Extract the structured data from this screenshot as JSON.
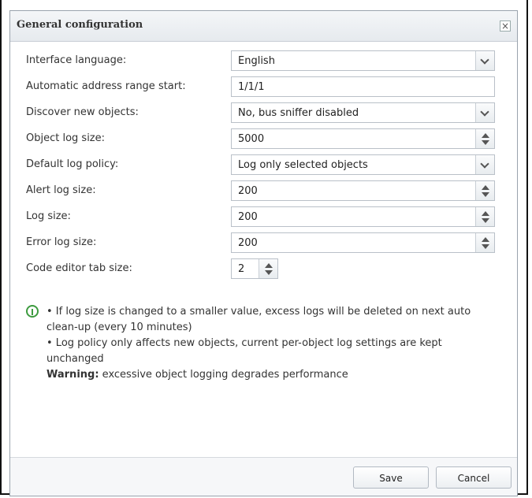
{
  "dialog": {
    "title": "General configuration",
    "close_label": "×"
  },
  "fields": [
    {
      "label": "Interface language:",
      "value": "English",
      "control": "select"
    },
    {
      "label": "Automatic address range start:",
      "value": "1/1/1",
      "control": "text"
    },
    {
      "label": "Discover new objects:",
      "value": "No, bus sniffer disabled",
      "control": "select"
    },
    {
      "label": "Object log size:",
      "value": "5000",
      "control": "spinner"
    },
    {
      "label": "Default log policy:",
      "value": "Log only selected objects",
      "control": "select"
    },
    {
      "label": "Alert log size:",
      "value": "200",
      "control": "spinner"
    },
    {
      "label": "Log size:",
      "value": "200",
      "control": "spinner"
    },
    {
      "label": "Error log size:",
      "value": "200",
      "control": "spinner"
    },
    {
      "label": "Code editor tab size:",
      "value": "2",
      "control": "spinner-small"
    }
  ],
  "notes": {
    "line1": "• If log size is changed to a smaller value, excess logs will be deleted on next auto clean-up (every 10 minutes)",
    "line2": "• Log policy only affects new objects, current per-object log settings are kept unchanged",
    "warning_label": "Warning:",
    "warning_text": "excessive object logging degrades performance"
  },
  "buttons": {
    "save": "Save",
    "cancel": "Cancel"
  }
}
